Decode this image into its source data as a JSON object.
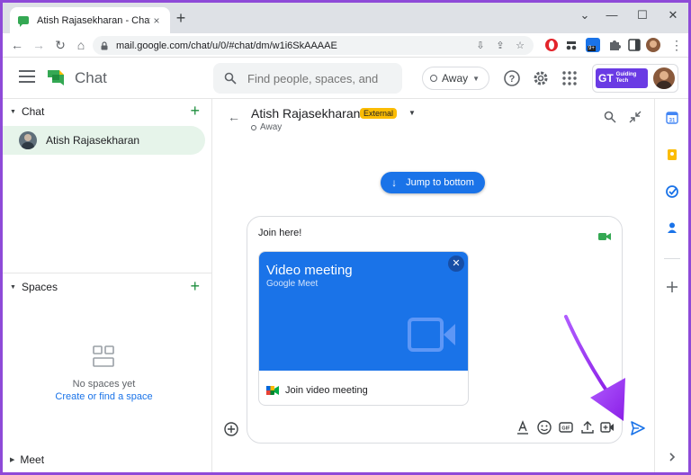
{
  "browser": {
    "tab_title": "Atish Rajasekharan - Chat",
    "tab_close": "×",
    "new_tab": "+",
    "url": "mail.google.com/chat/u/0/#chat/dm/w1i6SkAAAAE",
    "ext_badge": "9+"
  },
  "header": {
    "app_name": "Chat",
    "search_placeholder": "Find people, spaces, and",
    "status_label": "Away",
    "brand_text": "Guiding Tech"
  },
  "sidebar": {
    "chat_section": "Chat",
    "dm_name": "Atish Rajasekharan",
    "spaces_section": "Spaces",
    "empty_text": "No spaces yet",
    "empty_link": "Create or find a space",
    "meet_section": "Meet"
  },
  "conversation": {
    "name": "Atish Rajasekharan",
    "badge": "External",
    "status": "Away",
    "jump_label": "Jump to bottom"
  },
  "composer": {
    "draft_text": "Join here!",
    "card_title": "Video meeting",
    "card_subtitle": "Google Meet",
    "card_action": "Join video meeting"
  },
  "colors": {
    "accent": "#1a73e8",
    "chat_green": "#1e8e3e",
    "annotation_purple": "#9b30ff",
    "border_purple": "#8e4ad8"
  }
}
